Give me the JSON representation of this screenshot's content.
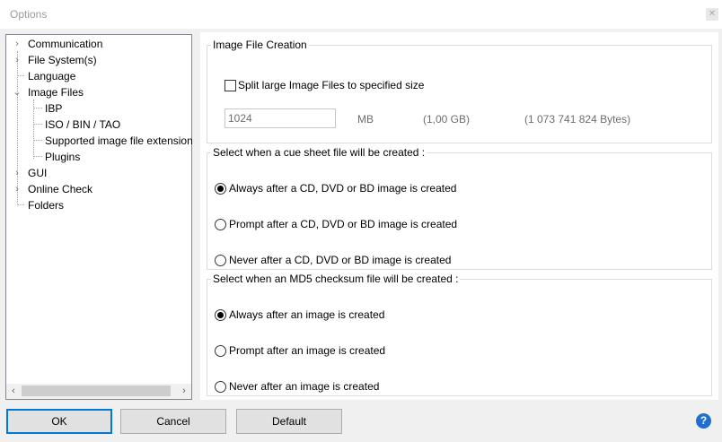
{
  "window": {
    "title": "Options"
  },
  "tree": {
    "items": [
      {
        "label": "Communication",
        "expander": "›"
      },
      {
        "label": "File System(s)",
        "expander": "›"
      },
      {
        "label": "Language",
        "expander": ""
      },
      {
        "label": "Image Files",
        "expander": "⌄"
      },
      {
        "label": "IBP"
      },
      {
        "label": "ISO / BIN / TAO"
      },
      {
        "label": "Supported image file extension"
      },
      {
        "label": "Plugins"
      },
      {
        "label": "GUI",
        "expander": "›"
      },
      {
        "label": "Online Check",
        "expander": "›"
      },
      {
        "label": "Folders",
        "expander": ""
      }
    ],
    "scroll_left": "‹",
    "scroll_right": "›"
  },
  "image_file_creation": {
    "legend": "Image File Creation",
    "split_label": "Split large Image Files to specified size",
    "size_value": "1024",
    "unit": "MB",
    "gb": "(1,00 GB)",
    "bytes": "(1 073 741 824 Bytes)"
  },
  "cue_sheet": {
    "legend": "Select when a cue sheet file will be created :",
    "options": [
      "Always after a CD, DVD or BD image is created",
      "Prompt after a CD, DVD or BD image is created",
      "Never after a CD, DVD or BD image is created"
    ]
  },
  "md5": {
    "legend": "Select when an MD5 checksum file will be created :",
    "options": [
      "Always after an image is created",
      "Prompt after an image is created",
      "Never after an image is created"
    ]
  },
  "buttons": {
    "ok": "OK",
    "cancel": "Cancel",
    "default": "Default",
    "help": "?"
  }
}
